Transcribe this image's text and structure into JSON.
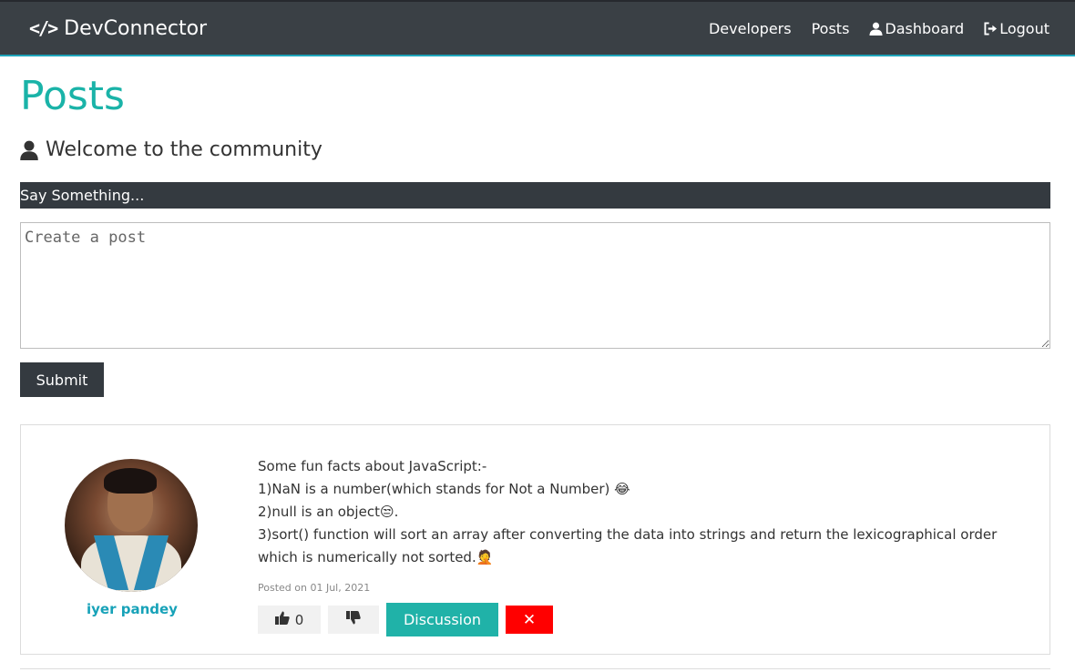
{
  "navbar": {
    "brand_label": "DevConnector",
    "brand_icon": "code-icon",
    "links": [
      {
        "label": "Developers"
      },
      {
        "label": "Posts"
      },
      {
        "label": "Dashboard",
        "icon": "user-icon"
      },
      {
        "label": "Logout",
        "icon": "sign-out-icon"
      }
    ]
  },
  "page": {
    "title": "Posts",
    "lead": "Welcome to the community",
    "lead_icon": "user-icon"
  },
  "post_form": {
    "header": "Say Something...",
    "textarea_placeholder": "Create a post",
    "submit_label": "Submit"
  },
  "posts": [
    {
      "user_name": "iyer pandey",
      "text": "Some fun facts about JavaScript:-\n1)NaN is a number(which stands for Not a Number) 😂\n2)null is an object😒.\n3)sort() function will sort an array after converting the data into strings and return the lexicographical order which is numerically not sorted.🤦",
      "date": "Posted on 01 Jul, 2021",
      "likes": "0",
      "discussion_label": "Discussion",
      "delete_label": "✕"
    }
  ],
  "colors": {
    "navbar_bg": "#343a40",
    "primary": "#20b2a8",
    "danger": "#ff0000",
    "light": "#f1f1f1"
  }
}
